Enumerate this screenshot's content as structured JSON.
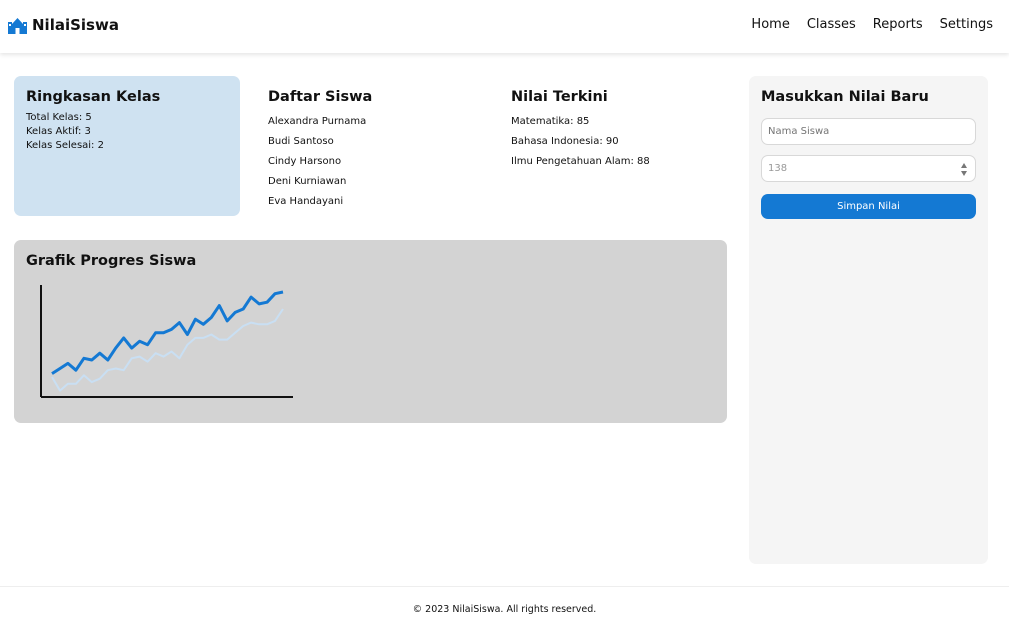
{
  "app": {
    "name": "NilaiSiswa",
    "icon": "school-building-icon",
    "accent": "#1479d3"
  },
  "nav": {
    "items": [
      "Home",
      "Classes",
      "Reports",
      "Settings"
    ]
  },
  "summary": {
    "title": "Ringkasan Kelas",
    "lines": [
      "Total Kelas: 5",
      "Kelas Aktif: 3",
      "Kelas Selesai: 2"
    ]
  },
  "students": {
    "title": "Daftar Siswa",
    "items": [
      "Alexandra Purnama",
      "Budi Santoso",
      "Cindy Harsono",
      "Deni Kurniawan",
      "Eva Handayani"
    ]
  },
  "recent_grades": {
    "title": "Nilai Terkini",
    "items": [
      "Matematika: 85",
      "Bahasa Indonesia: 90",
      "Ilmu Pengetahuan Alam: 88"
    ]
  },
  "progress_chart": {
    "title": "Grafik Progres Siswa"
  },
  "chart_data": {
    "type": "line",
    "title": "Grafik Progres Siswa",
    "x": [
      0,
      1,
      2,
      3,
      4,
      5,
      6,
      7,
      8,
      9,
      10,
      11,
      12,
      13,
      14,
      15,
      16,
      17,
      18,
      19,
      20,
      21,
      22,
      23,
      24,
      25,
      26,
      27,
      28,
      29
    ],
    "series": [
      {
        "color": "#1479d3",
        "values": [
          2,
          5,
          8,
          4,
          11,
          10,
          14,
          10,
          17,
          23,
          17,
          21,
          19,
          26,
          26,
          28,
          32,
          25,
          34,
          31,
          35,
          42,
          33,
          38,
          40,
          47,
          43,
          44,
          49,
          50
        ]
      },
      {
        "color": "#c9dff3",
        "values": [
          0,
          -8,
          -4,
          -4,
          1,
          -3,
          -1,
          4,
          5,
          4,
          11,
          12,
          9,
          14,
          12,
          15,
          11,
          19,
          23,
          23,
          25,
          22,
          22,
          26,
          30,
          32,
          31,
          31,
          33,
          40
        ]
      }
    ],
    "xlabel": "",
    "ylabel": "",
    "grid": false
  },
  "form": {
    "title": "Masukkan Nilai Baru",
    "name_placeholder": "Nama Siswa",
    "grade_value": "138",
    "save_label": "Simpan Nilai"
  },
  "footer": {
    "text": "© 2023 NilaiSiswa. All rights reserved."
  }
}
